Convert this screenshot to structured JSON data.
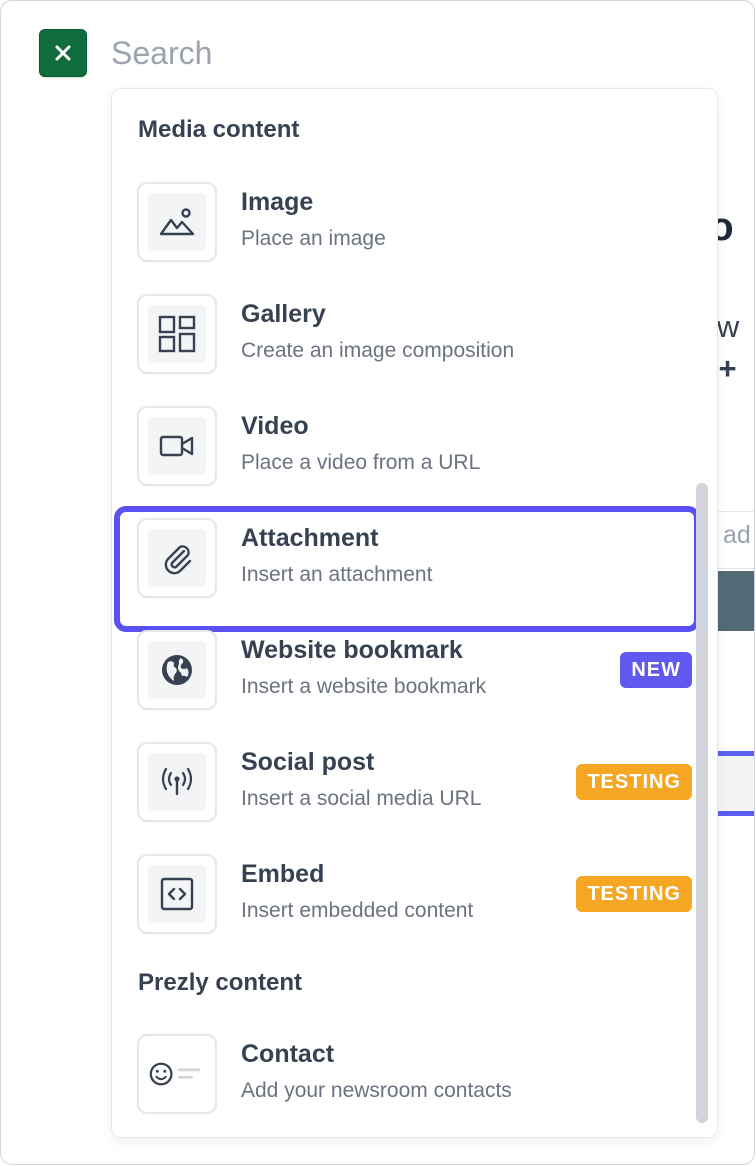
{
  "search": {
    "placeholder": "Search"
  },
  "colors": {
    "close_button": "#0f6d3d",
    "active_outline": "#5a4ff0",
    "badge_new": "#6159ef",
    "badge_testing": "#f5a623"
  },
  "background": {
    "title_fragment": "yo",
    "line1_fragment": "e w",
    "line2_fragment": "n +",
    "input_fragment": "ad"
  },
  "sections": {
    "media": {
      "title": "Media content"
    },
    "prezly": {
      "title": "Prezly content"
    }
  },
  "items": [
    {
      "label": "Image",
      "description": "Place an image",
      "icon": "image-icon"
    },
    {
      "label": "Gallery",
      "description": "Create an image composition",
      "icon": "gallery-icon"
    },
    {
      "label": "Video",
      "description": "Place a video from a URL",
      "icon": "video-icon"
    },
    {
      "label": "Attachment",
      "description": "Insert an attachment",
      "icon": "paperclip-icon",
      "active": true
    },
    {
      "label": "Website bookmark",
      "description": "Insert a website bookmark",
      "icon": "globe-icon",
      "badge": "NEW"
    },
    {
      "label": "Social post",
      "description": "Insert a social media URL",
      "icon": "broadcast-icon",
      "badge": "TESTING"
    },
    {
      "label": "Embed",
      "description": "Insert embedded content",
      "icon": "code-icon",
      "badge": "TESTING"
    },
    {
      "label": "Contact",
      "description": "Add your newsroom contacts",
      "icon": "contact-icon"
    }
  ]
}
